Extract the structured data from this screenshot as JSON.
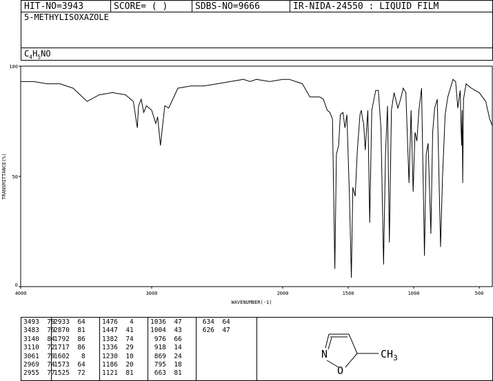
{
  "header": {
    "hit_no": "HIT-NO=3943",
    "score": "SCORE=  (  )",
    "sdbs_no": "SDBS-NO=9666",
    "ir_nida": "IR-NIDA-24550 : LIQUID FILM"
  },
  "compound": {
    "name": "5-METHYLISOXAZOLE",
    "formula_parts": [
      "C",
      "4",
      "H",
      "5",
      "NO"
    ]
  },
  "chart_data": {
    "type": "line",
    "title": "",
    "xlabel": "WAVENUMBER(-1)",
    "ylabel": "TRANSMITTANCE(%)",
    "xlim": [
      4000,
      400
    ],
    "ylim": [
      0,
      100
    ],
    "x_ticks": [
      "4000",
      "3000",
      "2000",
      "1500",
      "1000",
      "500"
    ],
    "y_ticks": [
      "100",
      "50",
      "0"
    ],
    "series": [
      {
        "name": "",
        "x": [
          4000,
          3900,
          3800,
          3700,
          3600,
          3493,
          3400,
          3300,
          3200,
          3140,
          3110,
          3100,
          3080,
          3061,
          3040,
          3000,
          2969,
          2955,
          2933,
          2900,
          2870,
          2800,
          2700,
          2600,
          2500,
          2400,
          2300,
          2250,
          2200,
          2100,
          2000,
          1950,
          1900,
          1850,
          1792,
          1760,
          1717,
          1690,
          1660,
          1640,
          1620,
          1602,
          1590,
          1573,
          1560,
          1540,
          1525,
          1510,
          1490,
          1476,
          1465,
          1447,
          1430,
          1410,
          1400,
          1390,
          1382,
          1370,
          1350,
          1336,
          1320,
          1290,
          1270,
          1250,
          1230,
          1215,
          1200,
          1186,
          1170,
          1150,
          1121,
          1100,
          1080,
          1060,
          1036,
          1020,
          1004,
          990,
          976,
          960,
          940,
          918,
          905,
          890,
          869,
          855,
          840,
          820,
          795,
          780,
          760,
          740,
          700,
          680,
          663,
          650,
          645,
          640,
          634,
          630,
          626,
          620,
          600,
          560,
          500,
          450,
          420,
          400
        ],
        "y": [
          93,
          93,
          92,
          92,
          90,
          84,
          87,
          88,
          87,
          84,
          72,
          82,
          85,
          79,
          82,
          80,
          74,
          77,
          64,
          82,
          81,
          90,
          91,
          91,
          92,
          93,
          94,
          93,
          94,
          93,
          94,
          94,
          93,
          92,
          86,
          86,
          86,
          85,
          80,
          79,
          76,
          8,
          60,
          64,
          78,
          79,
          72,
          78,
          40,
          4,
          45,
          41,
          62,
          78,
          80,
          76,
          74,
          62,
          80,
          29,
          80,
          89,
          89,
          72,
          10,
          60,
          82,
          20,
          80,
          88,
          81,
          85,
          90,
          88,
          47,
          80,
          43,
          70,
          66,
          80,
          90,
          14,
          60,
          65,
          24,
          70,
          81,
          85,
          18,
          50,
          78,
          86,
          94,
          93,
          81,
          87,
          89,
          75,
          64,
          80,
          47,
          85,
          92,
          90,
          88,
          84,
          76,
          73
        ]
      }
    ],
    "peak_table": [
      [
        [
          "3493",
          "79"
        ],
        [
          "3483",
          "79"
        ],
        [
          "3140",
          "84"
        ],
        [
          "3110",
          "72"
        ],
        [
          "3061",
          "79"
        ],
        [
          "2969",
          "74"
        ],
        [
          "2955",
          "77"
        ]
      ],
      [
        [
          "2933",
          "64"
        ],
        [
          "2870",
          "81"
        ],
        [
          "1792",
          "86"
        ],
        [
          "1717",
          "86"
        ],
        [
          "1602",
          "8"
        ],
        [
          "1573",
          "64"
        ],
        [
          "1525",
          "72"
        ]
      ],
      [
        [
          "1476",
          "4"
        ],
        [
          "1447",
          "41"
        ],
        [
          "1382",
          "74"
        ],
        [
          "1336",
          "29"
        ],
        [
          "1230",
          "10"
        ],
        [
          "1186",
          "20"
        ],
        [
          "1121",
          "81"
        ]
      ],
      [
        [
          "1036",
          "47"
        ],
        [
          "1004",
          "43"
        ],
        [
          "976",
          "66"
        ],
        [
          "918",
          "14"
        ],
        [
          "869",
          "24"
        ],
        [
          "795",
          "18"
        ],
        [
          "663",
          "81"
        ]
      ],
      [
        [
          "634",
          "64"
        ],
        [
          "626",
          "47"
        ]
      ]
    ]
  },
  "structure_labels": {
    "n": "N",
    "o": "O",
    "ch3": "CH3"
  }
}
